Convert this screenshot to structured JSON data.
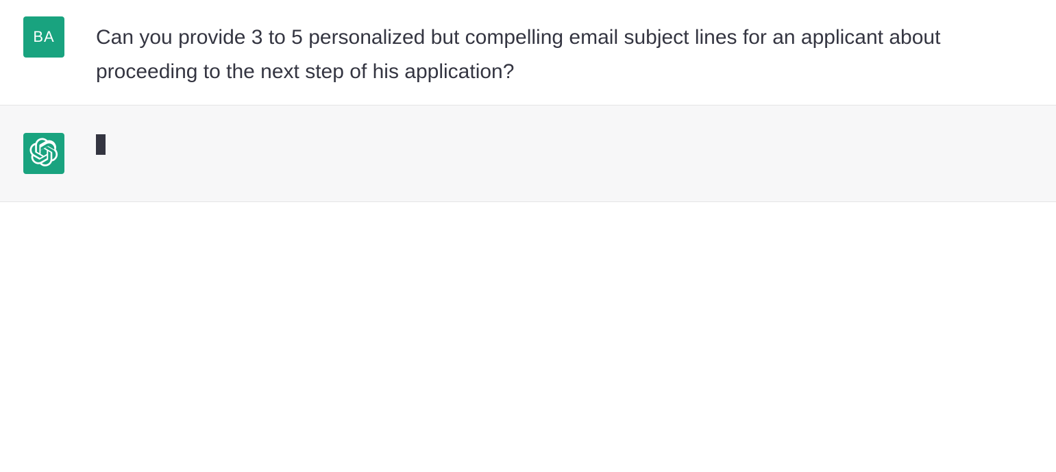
{
  "user": {
    "initials": "BA",
    "message": "Can you provide 3 to 5 personalized but compelling email subject lines for an applicant about proceeding to the next step of his application?"
  },
  "assistant": {
    "typing": true
  }
}
